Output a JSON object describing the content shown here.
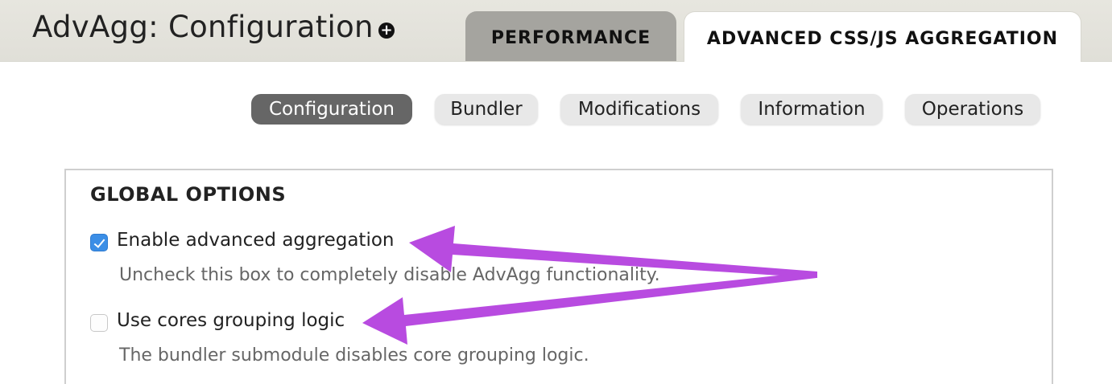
{
  "header": {
    "title": "AdvAgg: Configuration",
    "shortcut_icon": "plus-circle-icon",
    "tabs": [
      {
        "label": "PERFORMANCE",
        "active": false
      },
      {
        "label": "ADVANCED CSS/JS AGGREGATION",
        "active": true
      }
    ]
  },
  "secondary_tabs": [
    {
      "label": "Configuration",
      "active": true
    },
    {
      "label": "Bundler",
      "active": false
    },
    {
      "label": "Modifications",
      "active": false
    },
    {
      "label": "Information",
      "active": false
    },
    {
      "label": "Operations",
      "active": false
    }
  ],
  "global_options": {
    "legend": "GLOBAL OPTIONS",
    "options": [
      {
        "label": "Enable advanced aggregation",
        "description": "Uncheck this box to completely disable AdvAgg functionality.",
        "checked": true
      },
      {
        "label": "Use cores grouping logic",
        "description": "The bundler submodule disables core grouping logic.",
        "checked": false
      }
    ]
  },
  "colors": {
    "header_bg": "#e0dfd8",
    "active_secondary_tab": "#666666",
    "checkbox_checked": "#3b8ee6",
    "annotation_arrow": "#b84be0"
  }
}
